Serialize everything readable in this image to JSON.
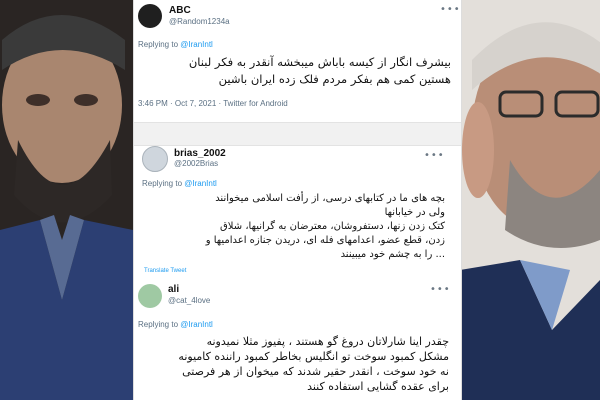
{
  "tweets": [
    {
      "name": "ABC",
      "handle": "@Random1234a",
      "replying_prefix": "Replying to ",
      "replying_to": "@IranIntl",
      "lines": [
        "بیشرف انگار از کیسه باباش میبخشه آنقدر به فکر لبنان",
        "هستین کمی هم بفکر مردم فلک زده ایران باشین"
      ],
      "timestamp": "3:46 PM · Oct 7, 2021 · Twitter for Android"
    },
    {
      "name": "brias_2002",
      "handle": "@2002Brias",
      "replying_prefix": "Replying to ",
      "replying_to": "@IranIntl",
      "lines": [
        "بچه های ما در کتابهای درسی، از رأفت اسلامی میخوانند",
        "ولی در خیابانها",
        "کتک زدن زنها، دستفروشان، معترضان به گرانیها، شلاق",
        "زدن، قطع عضو، اعدامهای فله ای، دریدن جنازه اعدامیها و",
        "... را به چشم خود میبینند"
      ],
      "translate_label": "Translate Tweet"
    },
    {
      "name": "ali",
      "handle": "@cat_4love",
      "replying_prefix": "Replying to ",
      "replying_to": "@IranIntl",
      "lines": [
        "چقدر اینا شارلاتان دروغ گو هستند ، پفیوز مثلا نمیدونه",
        "مشکل کمبود سوخت تو انگلیس بخاطر کمبود راننده کامیونه",
        "نه خود سوخت ، انقدر حقیر شدند که میخوان از هر فرصتی",
        "برای عقده گشایی استفاده کنند"
      ]
    }
  ],
  "more_icon": "more-horizontal-icon",
  "colors": {
    "link": "#1d9bf0",
    "secondary_text": "#5b7083"
  }
}
